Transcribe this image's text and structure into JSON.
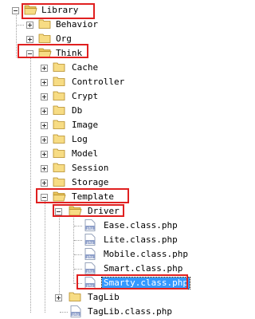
{
  "tree": {
    "root": "Library",
    "behavior": "Behavior",
    "org": "Org",
    "think": "Think",
    "cache": "Cache",
    "controller": "Controller",
    "crypt": "Crypt",
    "db": "Db",
    "image": "Image",
    "log": "Log",
    "model": "Model",
    "session": "Session",
    "storage": "Storage",
    "template": "Template",
    "driver": "Driver",
    "ease": "Ease.class.php",
    "lite": "Lite.class.php",
    "mobile": "Mobile.class.php",
    "smart": "Smart.class.php",
    "smarty": "Smarty.class.php",
    "taglib": "TagLib",
    "taglibfile": "TagLib.class.php"
  },
  "file_icon_text": "php"
}
